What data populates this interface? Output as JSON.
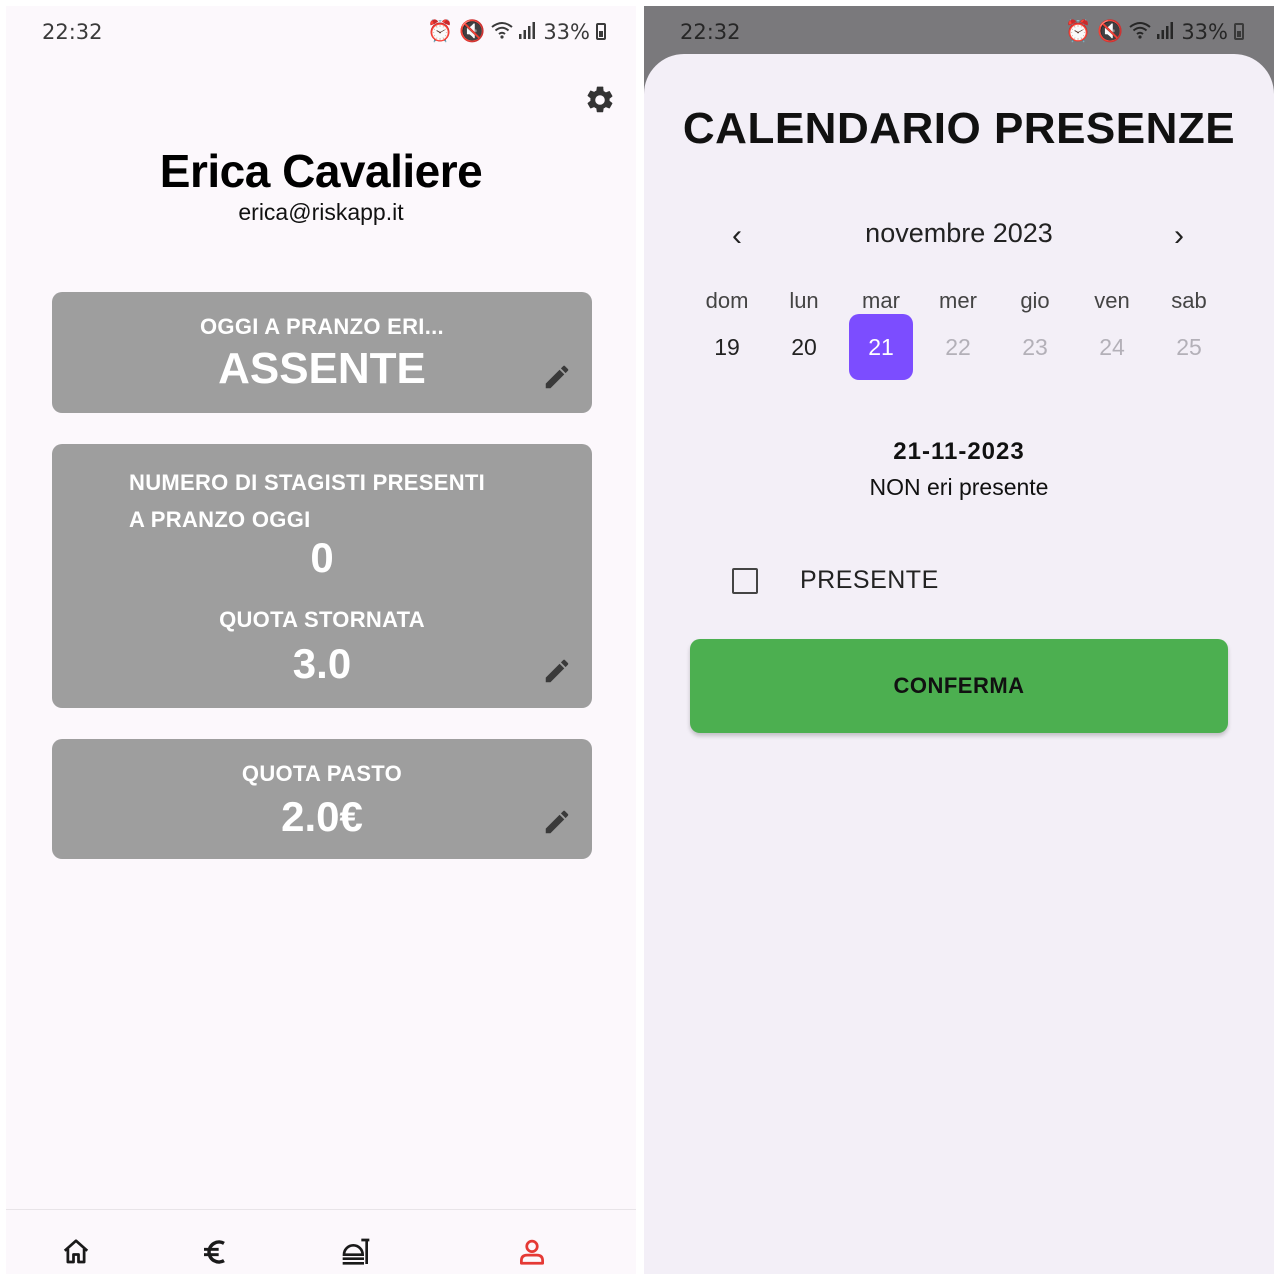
{
  "left_screen": {
    "status_bar": {
      "time": "22:32",
      "battery": "33%"
    },
    "profile": {
      "name": "Erica Cavaliere",
      "email": "erica@riskapp.it"
    },
    "lunch_card": {
      "caption": "OGGI A PRANZO ERI...",
      "value": "ASSENTE"
    },
    "interns_card": {
      "caption_line1": "NUMERO DI STAGISTI PRESENTI",
      "caption_line2": "A PRANZO OGGI",
      "count": "0",
      "quota_caption": "QUOTA STORNATA",
      "quota_value": "3.0"
    },
    "meal_card": {
      "caption": "QUOTA PASTO",
      "value": "2.0€"
    },
    "bottom_nav": [
      {
        "icon": "home-icon",
        "active": false
      },
      {
        "icon": "euro-icon",
        "active": false
      },
      {
        "icon": "food-tray-icon",
        "active": false
      },
      {
        "icon": "person-icon",
        "active": true
      }
    ]
  },
  "right_screen": {
    "status_bar": {
      "time": "22:32",
      "battery": "33%"
    },
    "title": "CALENDARIO PRESENZE",
    "month_label": "novembre 2023",
    "prev_icon": "‹",
    "next_icon": "›",
    "weekdays": [
      "dom",
      "lun",
      "mar",
      "mer",
      "gio",
      "ven",
      "sab"
    ],
    "days": [
      "19",
      "20",
      "21",
      "22",
      "23",
      "24",
      "25"
    ],
    "selected_day": "21",
    "selected_date": "21-11-2023",
    "selected_status": "NON eri presente",
    "checkbox_label": "PRESENTE",
    "checkbox_checked": false,
    "confirm_label": "CONFERMA"
  },
  "colors": {
    "card_gray": "#9e9e9e",
    "accent_purple": "#7c4dff",
    "confirm_green": "#4caf50",
    "nav_active": "#e53935"
  }
}
